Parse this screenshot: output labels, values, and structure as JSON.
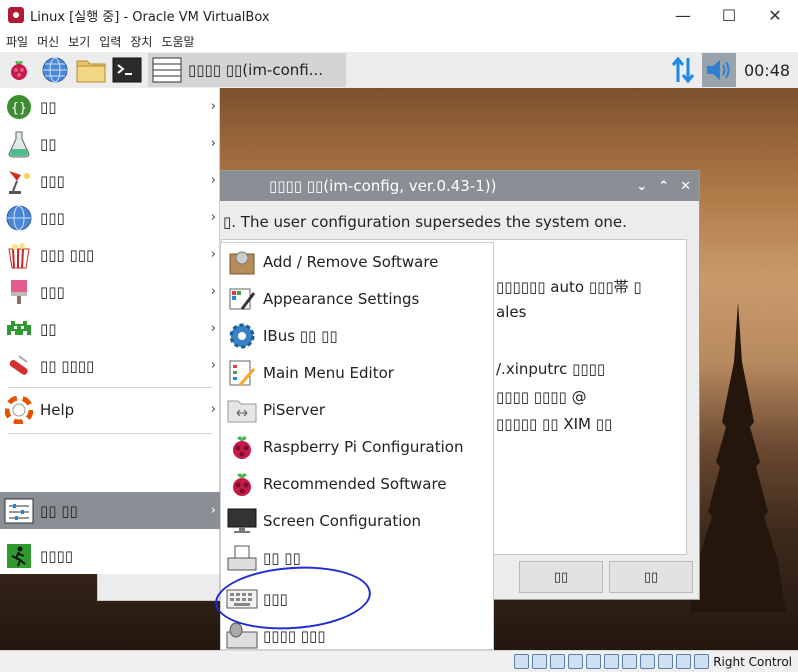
{
  "window": {
    "title": "Linux [실행 중] - Oracle VM VirtualBox",
    "controls": [
      "—",
      "☐",
      "✕"
    ]
  },
  "vbox_menu": [
    "파일",
    "머신",
    "보기",
    "입력",
    "장치",
    "도움말"
  ],
  "taskbar": {
    "active_window_label": "▯▯▯▯ ▯▯(im-confi...",
    "clock": "00:48"
  },
  "dialog": {
    "title": "▯▯▯▯ ▯▯(im-config, ver.0.43-1))",
    "message": "▯. The user configuration supersedes the system one.",
    "lines": [
      "▯▯▯▯▯▯ auto ▯▯▯帯 ▯",
      "ales",
      "/.xinputrc ▯▯▯▯",
      "▯▯▯▯ ▯▯▯▯ @",
      "▯▯▯▯▯ ▯▯ XIM ▯▯"
    ],
    "ok_button": "▯▯",
    "cancel_button": "▯▯"
  },
  "main_menu": [
    {
      "label": "▯▯",
      "icon": "programming-icon",
      "submenu": true
    },
    {
      "label": "▯▯",
      "icon": "education-icon",
      "submenu": true
    },
    {
      "label": "▯▯▯",
      "icon": "office-icon",
      "submenu": true
    },
    {
      "label": "▯▯▯",
      "icon": "internet-icon",
      "submenu": true
    },
    {
      "label": "▯▯▯ ▯▯▯",
      "icon": "sound-video-icon",
      "submenu": true
    },
    {
      "label": "▯▯▯",
      "icon": "graphics-icon",
      "submenu": true
    },
    {
      "label": "▯▯",
      "icon": "games-icon",
      "submenu": true
    },
    {
      "label": "▯▯ ▯▯▯▯",
      "icon": "accessories-icon",
      "submenu": true
    },
    {
      "label": "Help",
      "icon": "help-icon",
      "submenu": true
    },
    {
      "label": "▯▯ ▯▯",
      "icon": "preferences-icon",
      "submenu": true
    },
    {
      "label": "▯▯",
      "icon": "run-icon",
      "submenu": false
    },
    {
      "label": "▯▯▯▯",
      "icon": "shutdown-icon",
      "submenu": false
    }
  ],
  "sub_menu": [
    {
      "label": "Add / Remove Software",
      "icon": "package-icon"
    },
    {
      "label": "Appearance Settings",
      "icon": "appearance-icon"
    },
    {
      "label": "IBus ▯▯ ▯▯",
      "icon": "ibus-gear-icon"
    },
    {
      "label": "Main Menu Editor",
      "icon": "menu-editor-icon"
    },
    {
      "label": "PiServer",
      "icon": "folder-icon"
    },
    {
      "label": "Raspberry Pi Configuration",
      "icon": "raspberry-icon"
    },
    {
      "label": "Recommended Software",
      "icon": "raspberry-icon"
    },
    {
      "label": "Screen Configuration",
      "icon": "monitor-icon"
    },
    {
      "label": "▯▯ ▯▯",
      "icon": "input-method-icon"
    },
    {
      "label": "▯▯▯",
      "icon": "keyboard-icon"
    },
    {
      "label": "▯▯▯▯ ▯▯▯",
      "icon": "mouse-keyboard-icon"
    }
  ],
  "status_bar": {
    "host_key": "Right Control"
  }
}
